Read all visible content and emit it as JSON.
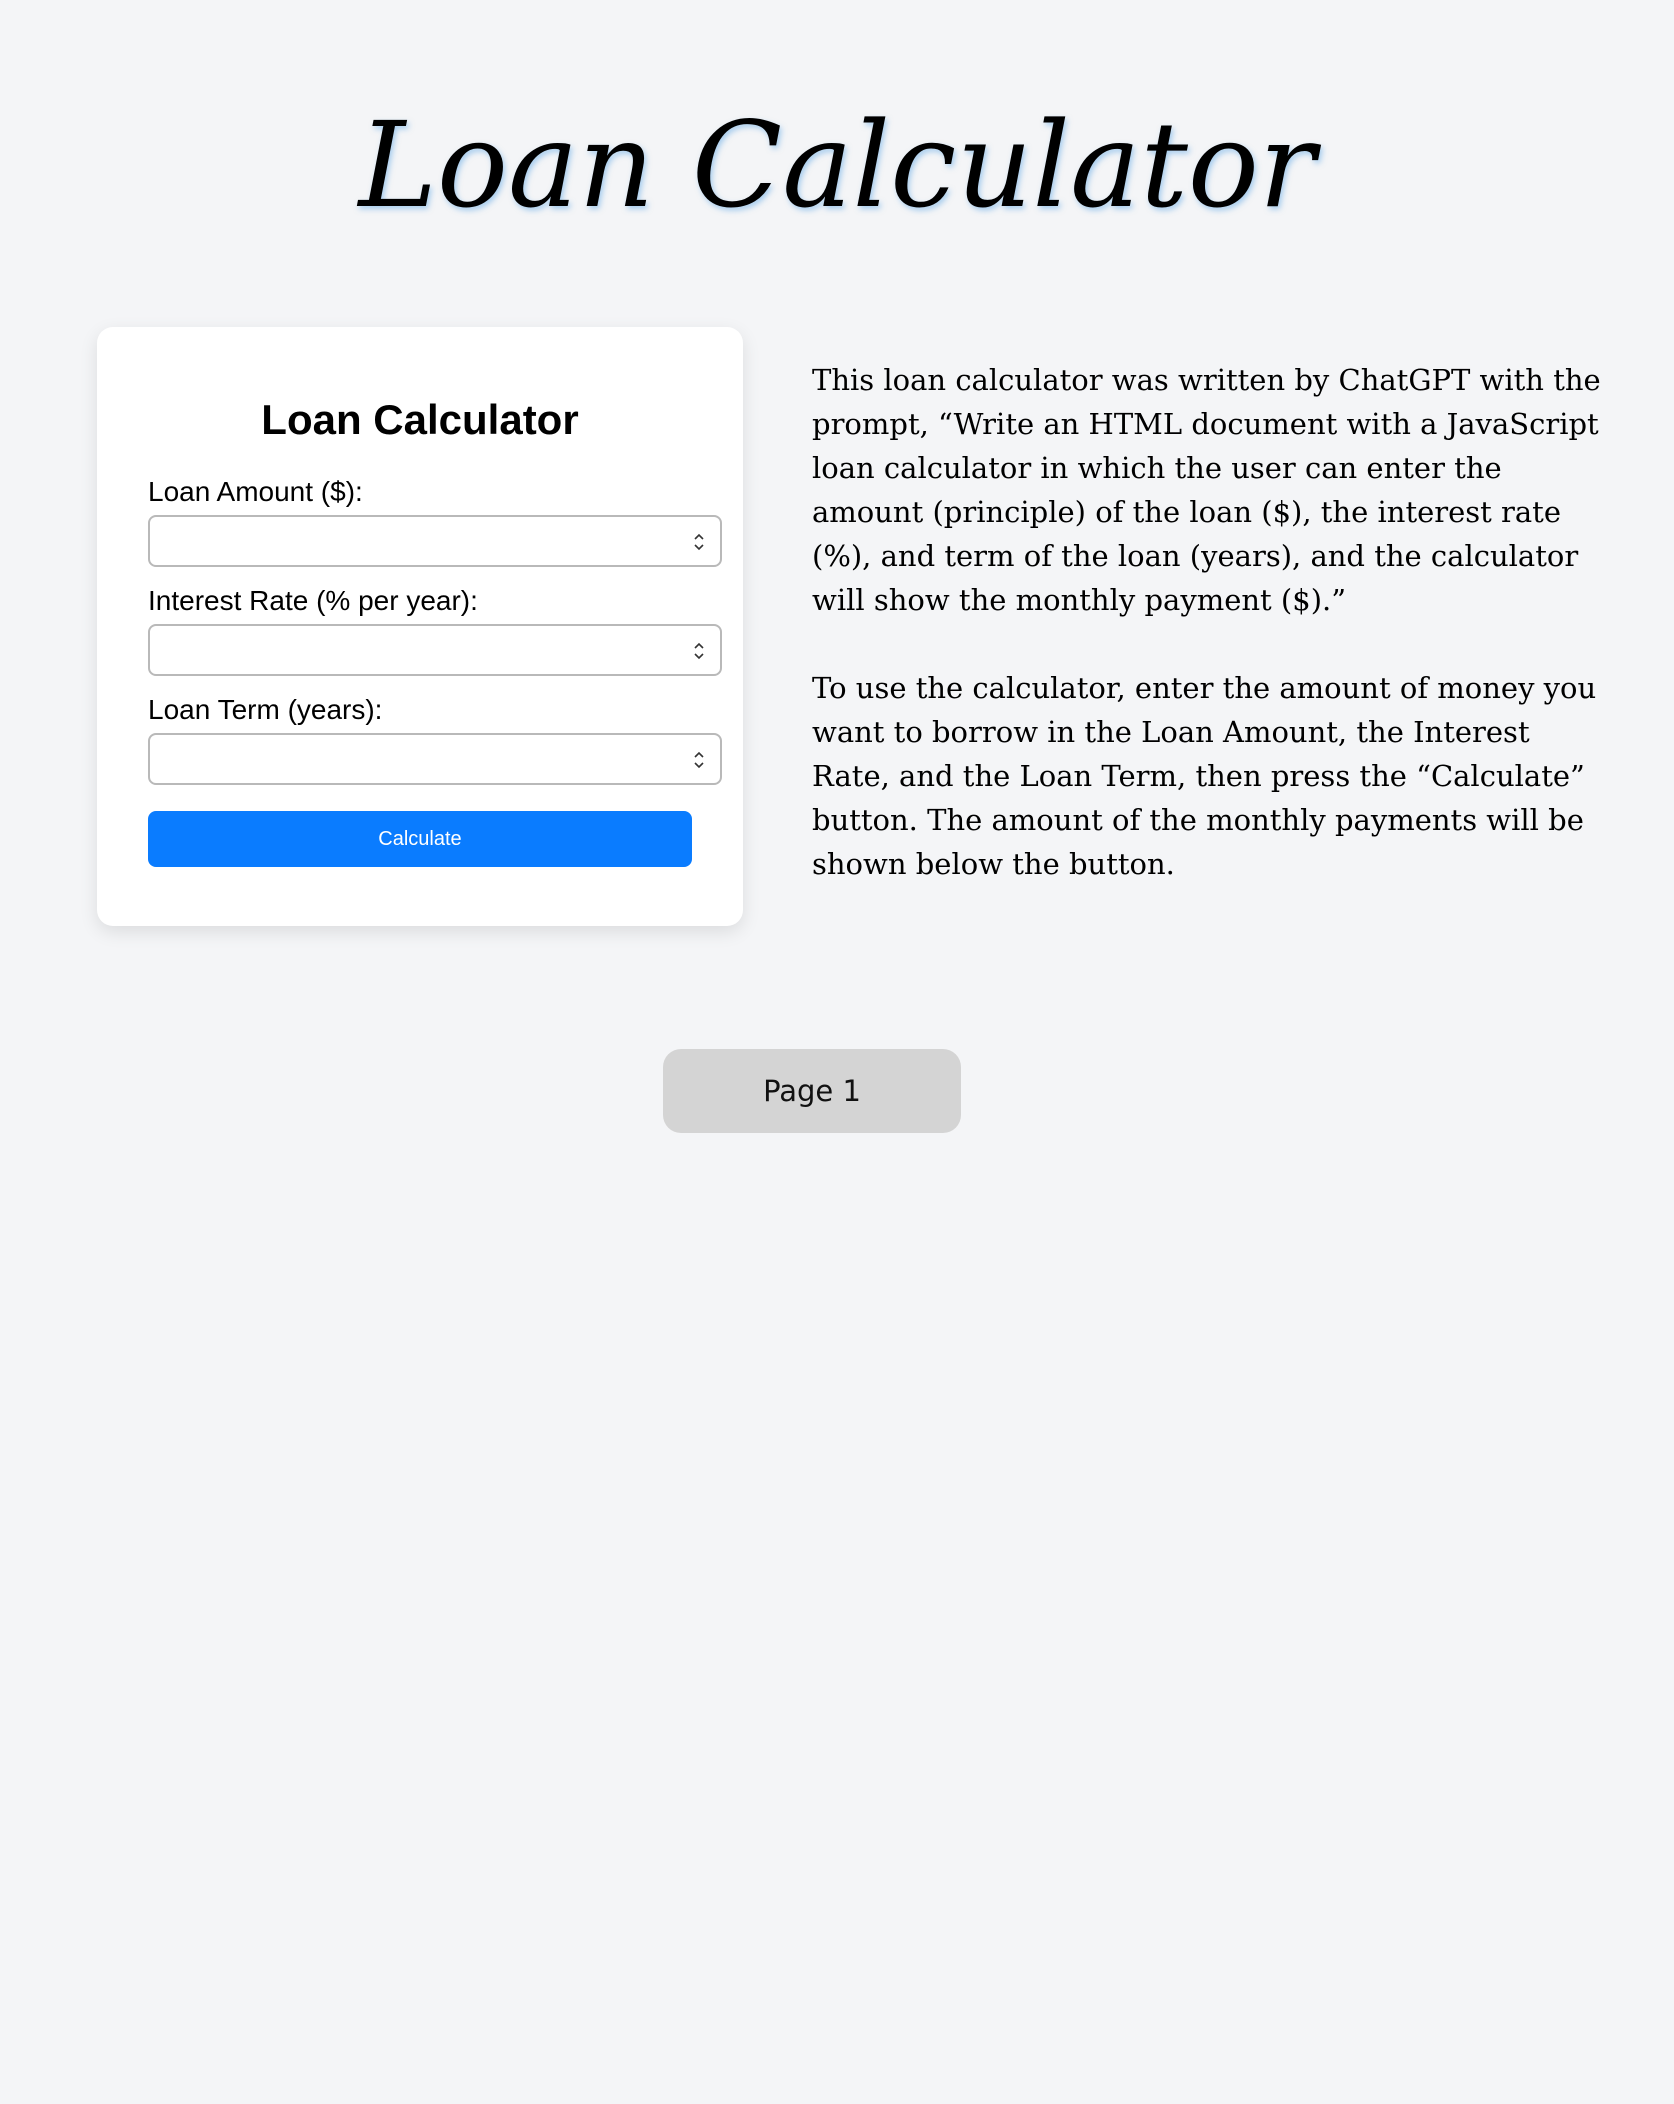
{
  "header": {
    "title": "Loan Calculator"
  },
  "calculator": {
    "title": "Loan Calculator",
    "fields": [
      {
        "label": "Loan Amount ($):",
        "value": ""
      },
      {
        "label": "Interest Rate (% per year):",
        "value": ""
      },
      {
        "label": "Loan Term (years):",
        "value": ""
      }
    ],
    "button_label": "Calculate",
    "button_color": "#0a7cff"
  },
  "description": {
    "paragraphs": [
      "This loan calculator was written by ChatGPT with the prompt, “Write an HTML document with a JavaScript loan calculator in which the user can enter the amount (principle) of the loan ($), the interest rate (%), and term of the loan (years), and the calculator will show the monthly payment ($).”",
      "To use the calculator, enter the amount of money you want to borrow in the Loan Amount, the Interest Rate, and the Loan Term, then press the “Calculate” button. The amount of the monthly payments will be shown below the button."
    ]
  },
  "pagination": {
    "label": "Page 1"
  }
}
